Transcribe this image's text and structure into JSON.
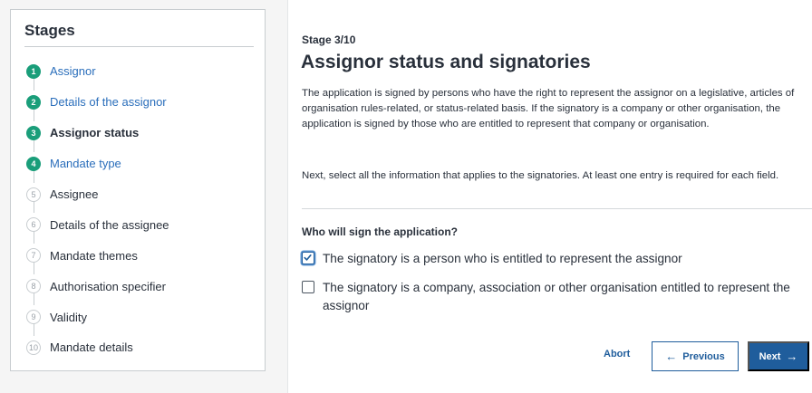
{
  "stages": {
    "title": "Stages",
    "items": [
      {
        "number": "1",
        "label": "Assignor",
        "state": "done"
      },
      {
        "number": "2",
        "label": "Details of the assignor",
        "state": "done"
      },
      {
        "number": "3",
        "label": "Assignor status",
        "state": "current"
      },
      {
        "number": "4",
        "label": "Mandate type",
        "state": "done"
      },
      {
        "number": "5",
        "label": "Assignee",
        "state": "todo"
      },
      {
        "number": "6",
        "label": "Details of the assignee",
        "state": "todo"
      },
      {
        "number": "7",
        "label": "Mandate themes",
        "state": "todo"
      },
      {
        "number": "8",
        "label": "Authorisation specifier",
        "state": "todo"
      },
      {
        "number": "9",
        "label": "Validity",
        "state": "todo"
      },
      {
        "number": "10",
        "label": "Mandate details",
        "state": "todo"
      }
    ]
  },
  "main": {
    "stage_counter": "Stage 3/10",
    "title": "Assignor status and signatories",
    "intro": "The application is signed by persons who have the right to represent the assignor on a legislative, articles of organisation rules-related, or status-related basis. If the signatory is a company or other organisation, the application is signed by those who are entitled to represent that company or organisation.",
    "select_info": "Next, select all the information that applies to the signatories. At least one entry is required for each field.",
    "question": "Who will sign the application?",
    "options": [
      {
        "label": "The signatory is a person who is entitled to represent the assignor",
        "checked": true
      },
      {
        "label": "The signatory is a company, association or other organisation entitled to represent the assignor",
        "checked": false
      }
    ]
  },
  "buttons": {
    "abort": "Abort",
    "previous": "Previous",
    "next": "Next",
    "previous_icon": "arrow-left-icon",
    "next_icon": "arrow-right-icon"
  },
  "colors": {
    "done": "#1a9e7a",
    "link": "#2a6ebb",
    "primary": "#1f5d9c"
  }
}
